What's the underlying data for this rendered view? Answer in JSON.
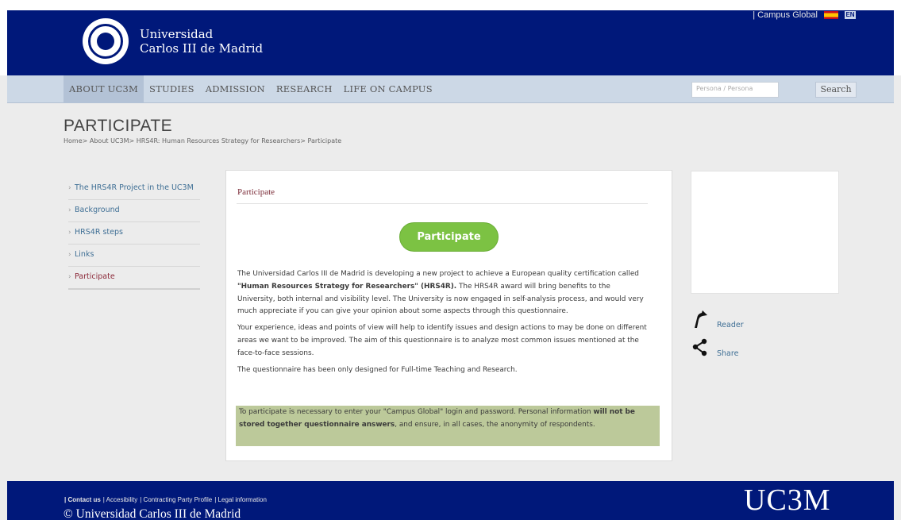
{
  "header": {
    "logo_line1": "Universidad",
    "logo_line2": "Carlos III de Madrid",
    "top_link": "| Campus Global",
    "lang_badge": "EN",
    "brand_color": "#00187a"
  },
  "nav": {
    "items": [
      {
        "label": "ABOUT UC3M",
        "active": true
      },
      {
        "label": "STUDIES"
      },
      {
        "label": "ADMISSION"
      },
      {
        "label": "RESEARCH"
      },
      {
        "label": "LIFE ON CAMPUS"
      }
    ],
    "search_placeholder": "Persona / Persona",
    "search_button": "Search"
  },
  "page": {
    "title": "PARTICIPATE",
    "breadcrumb": "Home> About UC3M> HRS4R: Human Resources Strategy for Researchers> Participate"
  },
  "sidebar": {
    "items": [
      {
        "label": "The HRS4R Project in the UC3M"
      },
      {
        "label": "Background"
      },
      {
        "label": "HRS4R steps"
      },
      {
        "label": "Links"
      },
      {
        "label": "Participate",
        "current": true
      }
    ]
  },
  "main": {
    "panel_title": "Participate",
    "cta_label": "Participate",
    "cta_color": "#7cc243",
    "p1_before": "The Universidad Carlos III de Madrid is developing a new project to achieve a European quality certification called ",
    "p1_bold": "\"Human Resources Strategy for Researchers\" (HRS4R).",
    "p1_after": " The HRS4R award will bring benefits to the University, both internal and visibility level. The University is now engaged in self-analysis process, and would very much appreciate if you can give your opinion about some aspects through this questionnaire.",
    "p2": "Your experience, ideas and points of view will help to identify issues and design actions to may be done on different areas we want to be improved. The aim of this questionnaire is to analyze most common issues mentioned at the face-to-face sessions.",
    "p3": "The questionnaire has been only designed for Full-time Teaching and Research.",
    "notice_before": "To participate is necessary to enter your \"Campus Global\" login and password. Personal information ",
    "notice_bold": "will not be stored together questionnaire answers",
    "notice_after": ", and ensure, in all cases, the anonymity of respondents.",
    "notice_color": "#bcc99a"
  },
  "tools": {
    "reader": "Reader",
    "share": "Share"
  },
  "footer": {
    "links": [
      {
        "label": "| Contact us",
        "bold": true
      },
      {
        "label": "| Accesibility"
      },
      {
        "label": "| Contracting Party Profile"
      },
      {
        "label": "| Legal information"
      }
    ],
    "copyright": "© Universidad Carlos III de Madrid",
    "brand": "UC3M"
  }
}
